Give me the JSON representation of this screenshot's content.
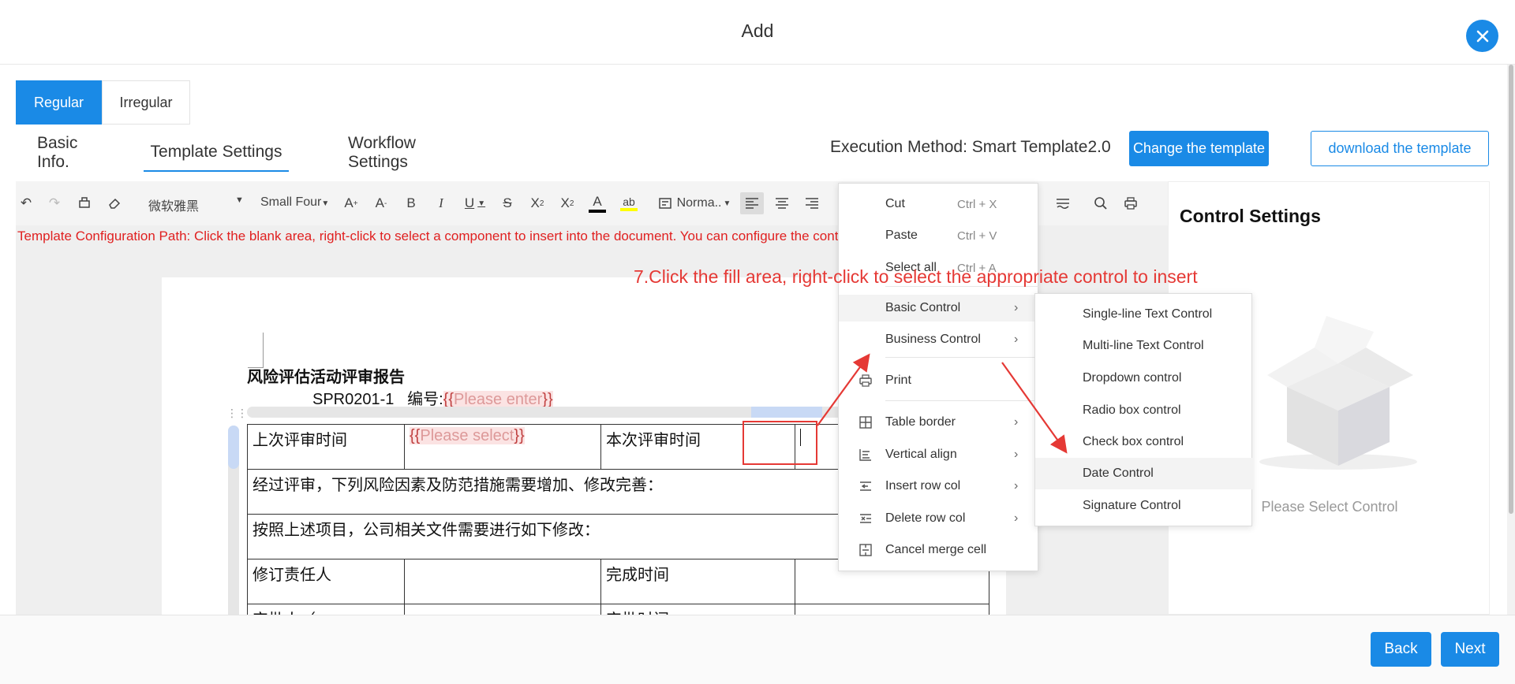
{
  "modal": {
    "title": "Add"
  },
  "mode": {
    "regular": "Regular",
    "irregular": "Irregular",
    "selected": "Regular"
  },
  "tabs": [
    {
      "label": "Basic Info."
    },
    {
      "label": "Template Settings",
      "active": true
    },
    {
      "label": "Workflow Settings"
    }
  ],
  "header_right": {
    "execution_method": "Execution Method: Smart Template2.0",
    "change_template": "Change the template",
    "download_template": "download the template"
  },
  "toolbar": {
    "font_family": "微软雅黑",
    "font_size": "Small Four",
    "paragraph_style": "Norma..",
    "font_color": "#000000",
    "highlight_color": "#ffff00"
  },
  "hint": "Template Configuration Path: Click the blank area, right-click to select a component to insert into the document. You can configure the control properties for this field on",
  "document": {
    "title": "风险评估活动评审报告",
    "code": "SPR0201-1",
    "number_label": "编号:",
    "enter_placeholder": "Please enter",
    "select_placeholder": "Please select",
    "rows": {
      "last_review_time": "上次评审时间",
      "this_review_time": "本次评审时间",
      "risk_factors": "经过评审，下列风险因素及防范措施需要增加、修改完善：",
      "file_changes": "按照上述项目，公司相关文件需要进行如下修改：",
      "revision_owner": "修订责任人",
      "completion_time": "完成时间",
      "approver": "审批人（",
      "approval_time": "审批时间"
    }
  },
  "context_menu": {
    "cut": "Cut",
    "cut_shortcut": "Ctrl + X",
    "paste": "Paste",
    "paste_shortcut": "Ctrl + V",
    "select_all": "Select all",
    "select_all_shortcut": "Ctrl + A",
    "basic_control": "Basic Control",
    "business_control": "Business Control",
    "print": "Print",
    "table_border": "Table border",
    "vertical_align": "Vertical align",
    "insert_row_col": "Insert row col",
    "delete_row_col": "Delete row col",
    "cancel_merge": "Cancel merge cell"
  },
  "submenu": [
    "Single-line Text Control",
    "Multi-line Text Control",
    "Dropdown control",
    "Radio box control",
    "Check box control",
    "Date Control",
    "Signature Control"
  ],
  "annotation": "7.Click the fill area, right-click to select the appropriate control to insert",
  "settings": {
    "title": "Control Settings",
    "empty": "Please Select Control"
  },
  "footer": {
    "back": "Back",
    "next": "Next"
  }
}
